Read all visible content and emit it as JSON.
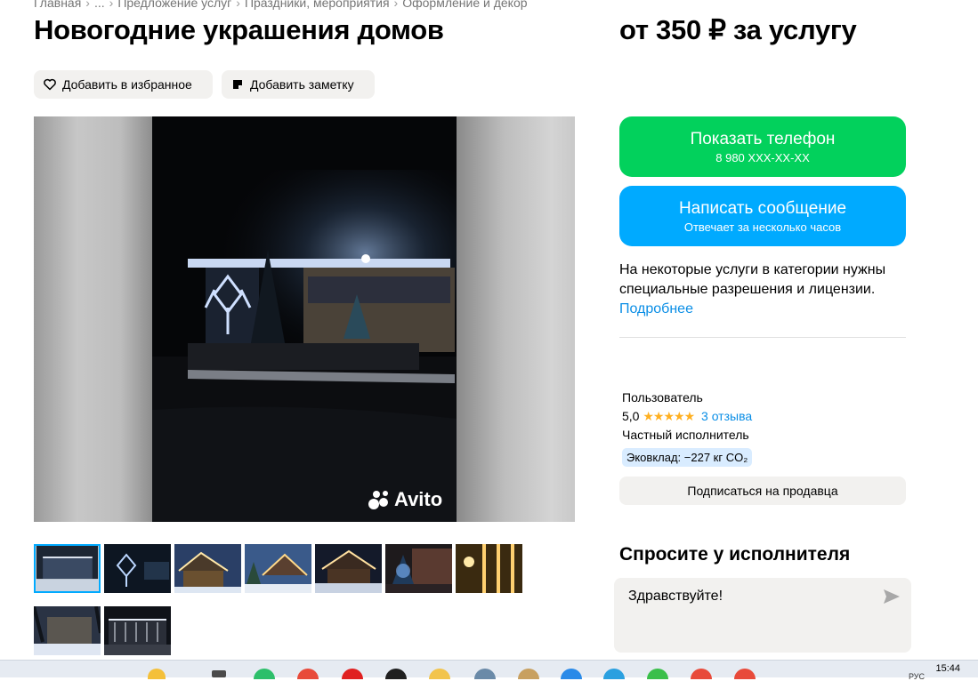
{
  "breadcrumbs": {
    "items": [
      "Главная",
      "...",
      "Предложение услуг",
      "Праздники, мероприятия",
      "Оформление и декор"
    ],
    "separator": "›"
  },
  "listing": {
    "title": "Новогодние украшения домов",
    "price": "от 350 ₽ за услугу"
  },
  "actions": {
    "favorite_label": "Добавить в избранное",
    "note_label": "Добавить заметку"
  },
  "gallery": {
    "watermark": "Avito",
    "thumbnails": [
      {
        "name": "thumb-building-night",
        "bg": "#1d2633",
        "accent": "#e8eef8"
      },
      {
        "name": "thumb-butterfly-lights",
        "bg": "#0d1622",
        "accent": "#bcd7ff"
      },
      {
        "name": "thumb-house-icicles",
        "bg": "#2a3f66",
        "accent": "#ffe7a8"
      },
      {
        "name": "thumb-house-dusk",
        "bg": "#3a5a8a",
        "accent": "#ffd98a"
      },
      {
        "name": "thumb-house-snow",
        "bg": "#141a2a",
        "accent": "#ffe0a0"
      },
      {
        "name": "thumb-tree-lights",
        "bg": "#1e1a1c",
        "accent": "#7fb8ff"
      },
      {
        "name": "thumb-warm-lights",
        "bg": "#3a2a10",
        "accent": "#ffd070"
      },
      {
        "name": "thumb-winter-house",
        "bg": "#2a3344",
        "accent": "#dfe6f2"
      },
      {
        "name": "thumb-facade-night",
        "bg": "#0f1218",
        "accent": "#e6ecf6"
      }
    ]
  },
  "contact": {
    "phone_label": "Показать телефон",
    "phone_number": "8 980 XXX-XX-XX",
    "message_label": "Написать сообщение",
    "message_sub": "Отвечает за несколько часов",
    "phone_color": "#02d15c",
    "message_color": "#00aaff"
  },
  "notice": {
    "text": "На некоторые услуги в категории нужны специальные разрешения и лицензии.",
    "link": "Подробнее"
  },
  "seller": {
    "name": "Пользователь",
    "rating": "5,0",
    "stars": "★★★★★",
    "reviews": "3 отзыва",
    "type": "Частный исполнитель",
    "eco": "Эковклад: −227 кг CO₂",
    "subscribe_label": "Подписаться на продавца"
  },
  "ask": {
    "title": "Спросите у исполнителя",
    "message": "Здравствуйте!"
  },
  "taskbar": {
    "time": "15:44",
    "lang": "РУС"
  }
}
